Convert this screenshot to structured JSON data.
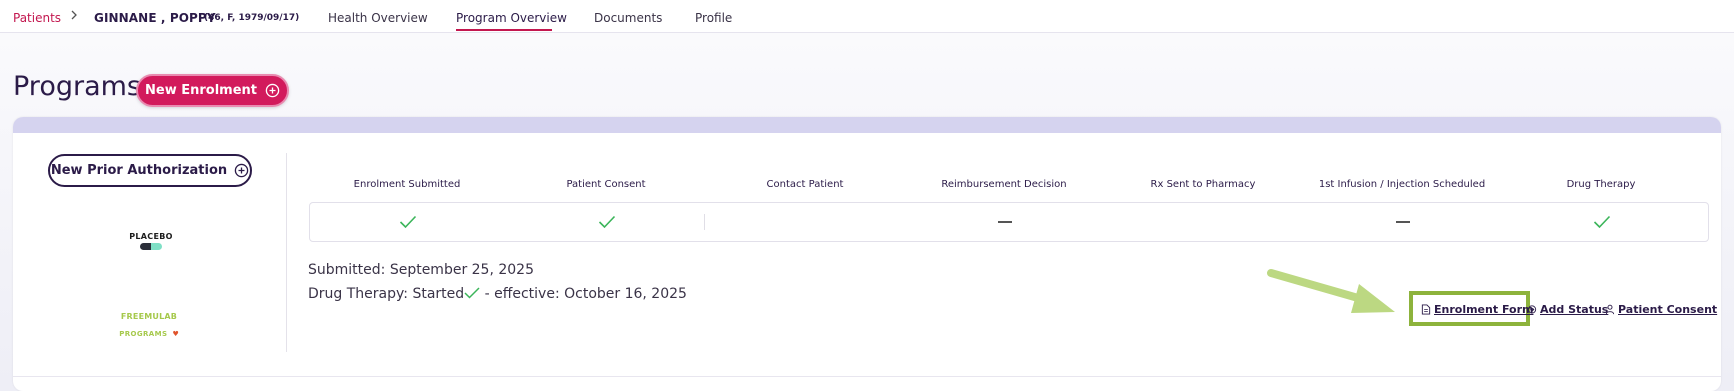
{
  "breadcrumb": {
    "patients_label": "Patients",
    "patient_name": "GINNANE , POPPY",
    "patient_meta": "(46, F, 1979/09/17)"
  },
  "tabs": [
    {
      "label": "Health Overview",
      "active": false
    },
    {
      "label": "Program Overview",
      "active": true
    },
    {
      "label": "Documents",
      "active": false
    },
    {
      "label": "Profile",
      "active": false
    }
  ],
  "page": {
    "title": "Programs",
    "new_enrolment_label": "New Enrolment"
  },
  "left_panel": {
    "prior_auth_label": "New Prior Authorization",
    "brand_logo": "PLACEBO",
    "program_logo_line1": "FREEMULAB",
    "program_logo_line2": "PROGRAMS"
  },
  "steps": [
    {
      "label": "Enrolment Submitted",
      "status": "check"
    },
    {
      "label": "Patient Consent",
      "status": "check"
    },
    {
      "label": "Contact Patient",
      "status": "none"
    },
    {
      "label": "Reimbursement Decision",
      "status": "dash"
    },
    {
      "label": "Rx Sent to Pharmacy",
      "status": "none"
    },
    {
      "label": "1st Infusion / Injection Scheduled",
      "status": "dash"
    },
    {
      "label": "Drug Therapy",
      "status": "check"
    }
  ],
  "details": {
    "submitted": "Submitted: September 25, 2025",
    "drug_therapy_prefix": "Drug Therapy: Started",
    "drug_therapy_suffix": " - effective: October 16, 2025"
  },
  "actions": {
    "enrolment_form": "Enrolment Form",
    "add_status": "Add Status",
    "patient_consent": "Patient Consent"
  },
  "colors": {
    "brand_pink": "#d21a5c",
    "text_dark": "#2b1b48",
    "check_green": "#3bb55a",
    "highlight_green": "#8db33c"
  }
}
